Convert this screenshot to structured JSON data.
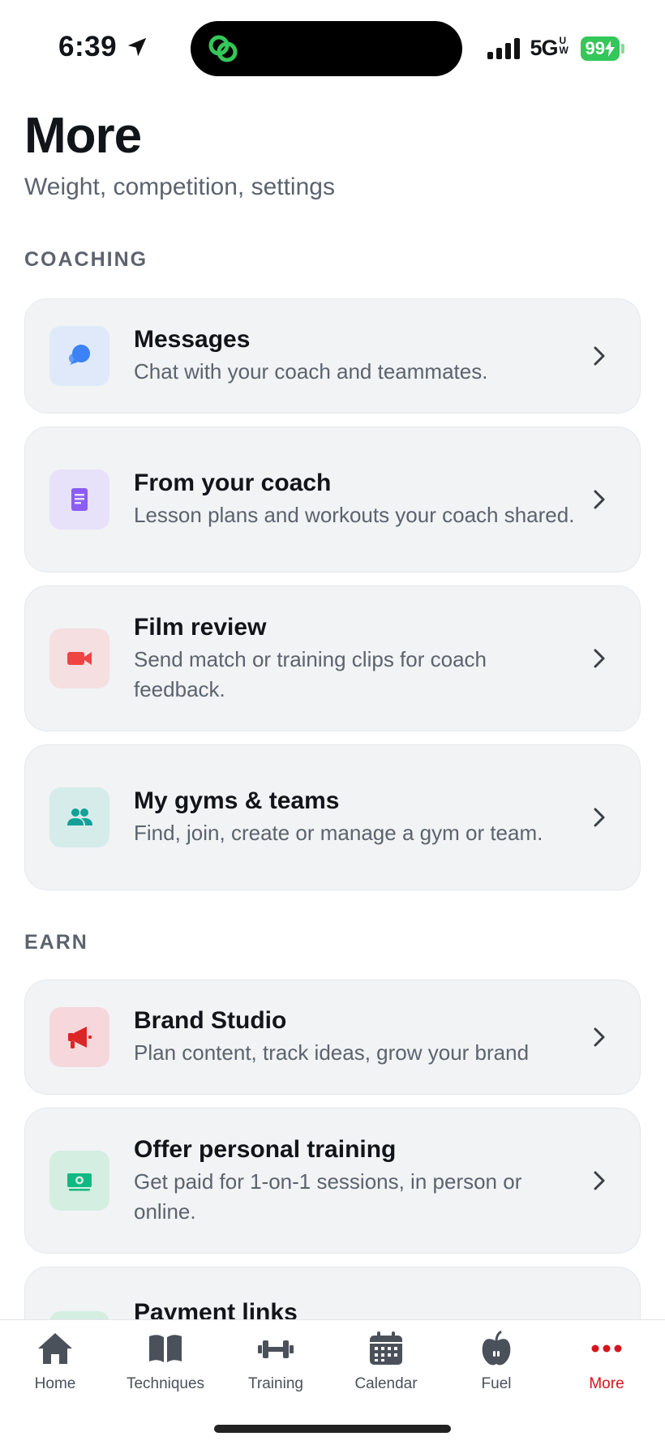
{
  "status": {
    "time": "6:39",
    "network": "5G",
    "network_sup": "UW",
    "battery": "99"
  },
  "header": {
    "title": "More",
    "subtitle": "Weight, competition, settings"
  },
  "sections": [
    {
      "label": "COACHING"
    },
    {
      "label": "EARN"
    }
  ],
  "items": [
    {
      "title": "Messages",
      "desc": "Chat with your coach and teammates.",
      "icon": "chat-icon",
      "tint": "#dfe9f9",
      "color": "#3b82f6"
    },
    {
      "title": "From your coach",
      "desc": "Lesson plans and workouts your coach shared.",
      "icon": "document-icon",
      "tint": "#e8e1fa",
      "color": "#8b5cf6"
    },
    {
      "title": "Film review",
      "desc": "Send match or training clips for coach feedback.",
      "icon": "video-camera-icon",
      "tint": "#f6dfe1",
      "color": "#ef4444"
    },
    {
      "title": "My gyms & teams",
      "desc": "Find, join, create or manage a gym or team.",
      "icon": "people-icon",
      "tint": "#d6ecea",
      "color": "#14a098"
    },
    {
      "title": "Brand Studio",
      "desc": "Plan content, track ideas, grow your brand",
      "icon": "megaphone-icon",
      "tint": "#f6d8dc",
      "color": "#dc2626"
    },
    {
      "title": "Offer personal training",
      "desc": "Get paid for 1-on-1 sessions, in person or online.",
      "icon": "money-icon",
      "tint": "#d5eee2",
      "color": "#10b981"
    },
    {
      "title": "Payment links",
      "desc": "",
      "icon": "link-icon",
      "tint": "#d5eee2",
      "color": "#10b981"
    }
  ],
  "tabs": [
    {
      "label": "Home",
      "icon": "home-icon"
    },
    {
      "label": "Techniques",
      "icon": "book-icon"
    },
    {
      "label": "Training",
      "icon": "dumbbell-icon"
    },
    {
      "label": "Calendar",
      "icon": "calendar-icon"
    },
    {
      "label": "Fuel",
      "icon": "apple-icon"
    },
    {
      "label": "More",
      "icon": "more-dots-icon",
      "active": true
    }
  ],
  "colors": {
    "accent": "#d7141d",
    "card_bg": "#f1f3f5",
    "muted_text": "#5c636e",
    "battery": "#34c759"
  }
}
